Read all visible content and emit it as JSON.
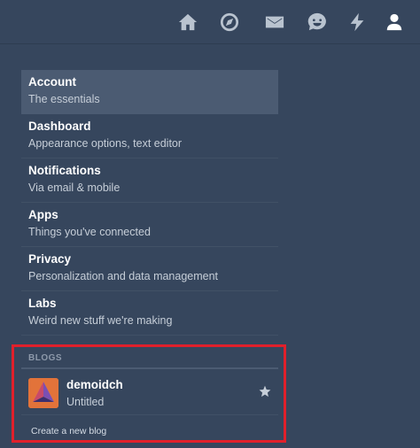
{
  "topnav": {
    "items": [
      {
        "icon": "home-icon"
      },
      {
        "icon": "compass-icon"
      },
      {
        "icon": "mail-icon"
      },
      {
        "icon": "chat-icon"
      },
      {
        "icon": "lightning-icon"
      },
      {
        "icon": "user-icon"
      }
    ]
  },
  "menu": {
    "items": [
      {
        "title": "Account",
        "subtitle": "The essentials"
      },
      {
        "title": "Dashboard",
        "subtitle": "Appearance options, text editor"
      },
      {
        "title": "Notifications",
        "subtitle": "Via email & mobile"
      },
      {
        "title": "Apps",
        "subtitle": "Things you've connected"
      },
      {
        "title": "Privacy",
        "subtitle": "Personalization and data management"
      },
      {
        "title": "Labs",
        "subtitle": "Weird new stuff we're making"
      }
    ]
  },
  "blogs": {
    "header": "BLOGS",
    "items": [
      {
        "name": "demoidch",
        "title": "Untitled",
        "icon": "star-icon"
      }
    ],
    "create_label": "Create a new blog"
  },
  "colors": {
    "background": "#36465d",
    "selected": "#4b5b72",
    "highlight": "#e0202b",
    "avatar": "#e2733a"
  }
}
